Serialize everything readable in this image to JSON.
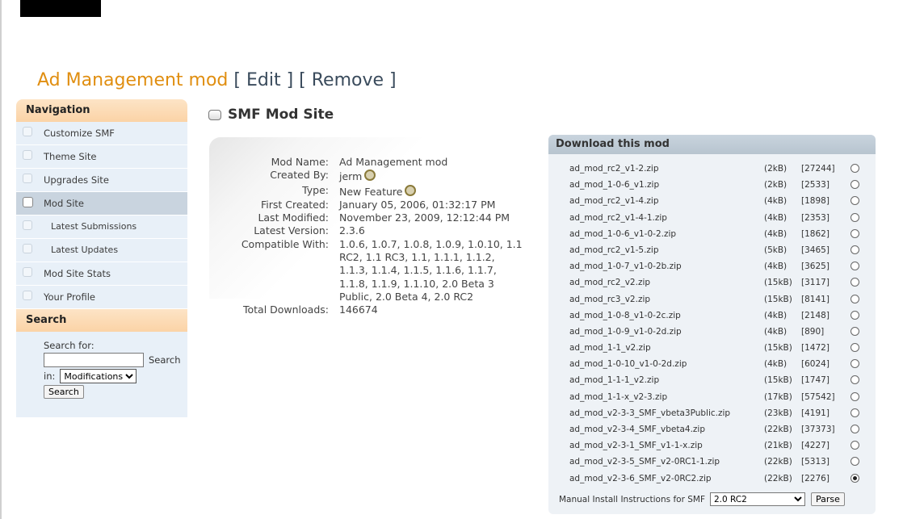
{
  "page": {
    "title": "Ad Management mod",
    "edit_link": "[ Edit ]",
    "remove_link": "[ Remove ]"
  },
  "sidebar": {
    "nav_header": "Navigation",
    "items": [
      {
        "label": "Customize SMF",
        "active": false,
        "sub": false
      },
      {
        "label": "Theme Site",
        "active": false,
        "sub": false
      },
      {
        "label": "Upgrades Site",
        "active": false,
        "sub": false
      },
      {
        "label": "Mod Site",
        "active": true,
        "sub": false
      },
      {
        "label": "Latest Submissions",
        "active": false,
        "sub": true
      },
      {
        "label": "Latest Updates",
        "active": false,
        "sub": true
      },
      {
        "label": "Mod Site Stats",
        "active": false,
        "sub": false
      },
      {
        "label": "Your Profile",
        "active": false,
        "sub": false
      }
    ],
    "search_header": "Search",
    "search_for_label": "Search for:",
    "search_link": "Search",
    "in_label": "in:",
    "in_selected": "Modifications",
    "search_button": "Search"
  },
  "mod_site_header": "SMF Mod Site",
  "info": {
    "rows": [
      {
        "key": "Mod Name:",
        "value": "Ad Management mod",
        "icon": false
      },
      {
        "key": "Created By:",
        "value": "jerm",
        "icon": true
      },
      {
        "key": "Type:",
        "value": "New Feature",
        "icon": true
      },
      {
        "key": "First Created:",
        "value": "January 05, 2006, 01:32:17 PM",
        "icon": false
      },
      {
        "key": "Last Modified:",
        "value": "November 23, 2009, 12:12:44 PM",
        "icon": false
      },
      {
        "key": "Latest Version:",
        "value": "2.3.6",
        "icon": false
      },
      {
        "key": "Compatible With:",
        "value": "1.0.6, 1.0.7, 1.0.8, 1.0.9, 1.0.10, 1.1 RC2, 1.1 RC3, 1.1, 1.1.1, 1.1.2, 1.1.3, 1.1.4, 1.1.5, 1.1.6, 1.1.7, 1.1.8, 1.1.9, 1.1.10, 2.0 Beta 3 Public, 2.0 Beta 4, 2.0 RC2",
        "icon": false
      },
      {
        "key": "Total Downloads:",
        "value": "146674",
        "icon": false
      }
    ]
  },
  "download": {
    "header": "Download this mod",
    "files": [
      {
        "name": "ad_mod_rc2_v1-2.zip",
        "size": "(2kB)",
        "count": "[27244]",
        "selected": false
      },
      {
        "name": "ad_mod_1-0-6_v1.zip",
        "size": "(2kB)",
        "count": "[2533]",
        "selected": false
      },
      {
        "name": "ad_mod_rc2_v1-4.zip",
        "size": "(4kB)",
        "count": "[1898]",
        "selected": false
      },
      {
        "name": "ad_mod_rc2_v1-4-1.zip",
        "size": "(4kB)",
        "count": "[2353]",
        "selected": false
      },
      {
        "name": "ad_mod_1-0-6_v1-0-2.zip",
        "size": "(4kB)",
        "count": "[1862]",
        "selected": false
      },
      {
        "name": "ad_mod_rc2_v1-5.zip",
        "size": "(5kB)",
        "count": "[3465]",
        "selected": false
      },
      {
        "name": "ad_mod_1-0-7_v1-0-2b.zip",
        "size": "(4kB)",
        "count": "[3625]",
        "selected": false
      },
      {
        "name": "ad_mod_rc2_v2.zip",
        "size": "(15kB)",
        "count": "[3117]",
        "selected": false
      },
      {
        "name": "ad_mod_rc3_v2.zip",
        "size": "(15kB)",
        "count": "[8141]",
        "selected": false
      },
      {
        "name": "ad_mod_1-0-8_v1-0-2c.zip",
        "size": "(4kB)",
        "count": "[2148]",
        "selected": false
      },
      {
        "name": "ad_mod_1-0-9_v1-0-2d.zip",
        "size": "(4kB)",
        "count": "[890]",
        "selected": false
      },
      {
        "name": "ad_mod_1-1_v2.zip",
        "size": "(15kB)",
        "count": "[1472]",
        "selected": false
      },
      {
        "name": "ad_mod_1-0-10_v1-0-2d.zip",
        "size": "(4kB)",
        "count": "[6024]",
        "selected": false
      },
      {
        "name": "ad_mod_1-1-1_v2.zip",
        "size": "(15kB)",
        "count": "[1747]",
        "selected": false
      },
      {
        "name": "ad_mod_1-1-x_v2-3.zip",
        "size": "(17kB)",
        "count": "[57542]",
        "selected": false
      },
      {
        "name": "ad_mod_v2-3-3_SMF_vbeta3Public.zip",
        "size": "(23kB)",
        "count": "[4191]",
        "selected": false
      },
      {
        "name": "ad_mod_v2-3-4_SMF_vbeta4.zip",
        "size": "(22kB)",
        "count": "[37373]",
        "selected": false
      },
      {
        "name": "ad_mod_v2-3-1_SMF_v1-1-x.zip",
        "size": "(21kB)",
        "count": "[4227]",
        "selected": false
      },
      {
        "name": "ad_mod_v2-3-5_SMF_v2-0RC1-1.zip",
        "size": "(22kB)",
        "count": "[5313]",
        "selected": false
      },
      {
        "name": "ad_mod_v2-3-6_SMF_v2-0RC2.zip",
        "size": "(22kB)",
        "count": "[2276]",
        "selected": true
      }
    ],
    "manual_label": "Manual Install Instructions for SMF",
    "smf_version_selected": "2.0 RC2",
    "parse_button": "Parse"
  }
}
